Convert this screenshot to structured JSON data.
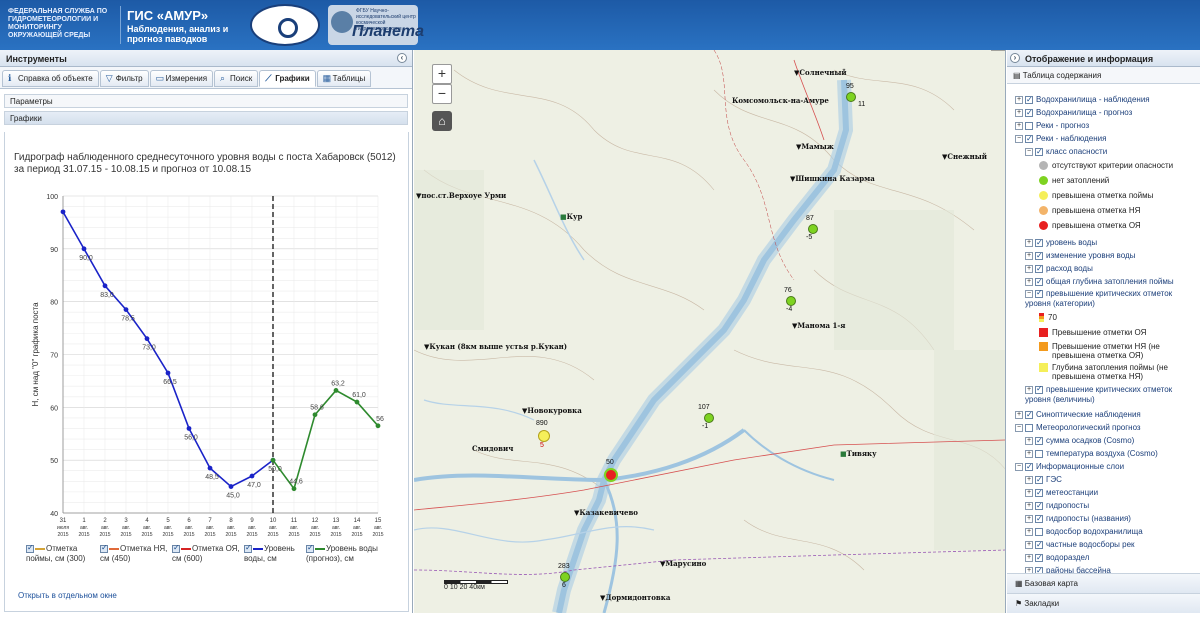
{
  "header": {
    "org": "ФЕДЕРАЛЬНАЯ СЛУЖБА ПО ГИДРОМЕТЕОРОЛОГИИ И МОНИТОРИНГУ ОКРУЖАЮЩЕЙ СРЕДЫ",
    "app_title": "ГИС «АМУР»",
    "app_subtitle": "Наблюдения, анализ и прогноз паводков",
    "logo2_small": "ФГБУ Научно-исследовательский центр космической гидрометеорологии",
    "logo2_big": "Планета"
  },
  "left": {
    "title": "Инструменты",
    "tabs": [
      {
        "label": "Справка об объекте",
        "icon": "info-icon"
      },
      {
        "label": "Фильтр",
        "icon": "filter-icon"
      },
      {
        "label": "Измерения",
        "icon": "ruler-icon"
      },
      {
        "label": "Поиск",
        "icon": "search-icon"
      },
      {
        "label": "Графики",
        "icon": "chart-icon"
      },
      {
        "label": "Таблицы",
        "icon": "table-icon"
      }
    ],
    "params_label": "Параметры",
    "graphs_label": "Графики",
    "open_link": "Открыть в отдельном окне"
  },
  "chart_data": {
    "type": "line",
    "title": "Гидрограф наблюденного среднесуточного уровня воды с поста Хабаровск (5012) за период 31.07.15 - 10.08.15 и прогноз от 10.08.15",
    "ylabel": "H, см над \"0\" графика поста",
    "ylim": [
      40,
      100
    ],
    "yticks": [
      40,
      50,
      60,
      70,
      80,
      90,
      100
    ],
    "xticks": [
      {
        "day": "31",
        "month": "июля",
        "year": "2015"
      },
      {
        "day": "1",
        "month": "авг.",
        "year": "2015"
      },
      {
        "day": "2",
        "month": "авг.",
        "year": "2015"
      },
      {
        "day": "3",
        "month": "авг.",
        "year": "2015"
      },
      {
        "day": "4",
        "month": "авг.",
        "year": "2015"
      },
      {
        "day": "5",
        "month": "авг.",
        "year": "2015"
      },
      {
        "day": "6",
        "month": "авг.",
        "year": "2015"
      },
      {
        "day": "7",
        "month": "авг.",
        "year": "2015"
      },
      {
        "day": "8",
        "month": "авг.",
        "year": "2015"
      },
      {
        "day": "9",
        "month": "авг.",
        "year": "2015"
      },
      {
        "day": "10",
        "month": "авг.",
        "year": "2015"
      },
      {
        "day": "11",
        "month": "авг.",
        "year": "2015"
      },
      {
        "day": "12",
        "month": "авг.",
        "year": "2015"
      },
      {
        "day": "13",
        "month": "авг.",
        "year": "2015"
      },
      {
        "day": "14",
        "month": "авг.",
        "year": "2015"
      },
      {
        "day": "15",
        "month": "авг.",
        "year": "2015"
      }
    ],
    "series": [
      {
        "name": "Уровень воды, см",
        "color": "#1a23c8",
        "x": [
          0,
          1,
          2,
          3,
          4,
          5,
          6,
          7,
          8,
          9,
          10
        ],
        "values": [
          97.0,
          90.0,
          83.0,
          78.5,
          73.0,
          66.5,
          56.0,
          48.5,
          45.0,
          47.0,
          50.0
        ],
        "labels": [
          "",
          "90,0",
          "83,0",
          "78,5",
          "73,0",
          "66,5",
          "56,0",
          "48,5",
          "45,0",
          "47,0",
          "50,0"
        ]
      },
      {
        "name": "Уровень воды (прогноз), см",
        "color": "#2e8a2e",
        "x": [
          10,
          11,
          12,
          13,
          14,
          15
        ],
        "values": [
          50.0,
          44.6,
          58.6,
          63.2,
          61.0,
          56.5
        ],
        "labels": [
          "",
          "44,6",
          "58,6",
          "63,2",
          "61,0",
          "56"
        ]
      }
    ],
    "forecast_divider_x": 10,
    "legend": [
      {
        "label": "Отметка поймы, см (300)",
        "color": "#d4a437"
      },
      {
        "label": "Отметка НЯ, см (450)",
        "color": "#e06a3a"
      },
      {
        "label": "Отметка ОЯ, см (600)",
        "color": "#d62424"
      },
      {
        "label": "Уровень воды, см",
        "color": "#1a23c8"
      },
      {
        "label": "Уровень воды (прогноз), см",
        "color": "#2e8a2e"
      }
    ]
  },
  "map": {
    "zoom_in": "+",
    "zoom_out": "−",
    "scale_label": "0   10   20      40км",
    "labels": [
      {
        "text": "Солнечный"
      },
      {
        "text": "Комсомольск-на-Амуре"
      },
      {
        "text": "Мамыж"
      },
      {
        "text": "Шишкина Казарма"
      },
      {
        "text": "Снежный"
      },
      {
        "text": "пос.ст.Верхоуе Урми"
      },
      {
        "text": "Кур"
      },
      {
        "text": "Кукан (8км выше устья р.Кукан)"
      },
      {
        "text": "Манома 1-я"
      },
      {
        "text": "Новокуровка"
      },
      {
        "text": "Смидович"
      },
      {
        "text": "Тивяку"
      },
      {
        "text": "Казакевичево"
      },
      {
        "text": "Марусино"
      },
      {
        "text": "Дормидонтовка"
      }
    ],
    "gauges": [
      {
        "value": "95",
        "sub": "11"
      },
      {
        "value": "87",
        "sub": "-5"
      },
      {
        "value": "76",
        "sub": "-4"
      },
      {
        "value": "107",
        "sub": "-1"
      },
      {
        "value": "890",
        "sub": "5"
      },
      {
        "value": "50",
        "sub": ""
      },
      {
        "value": "283",
        "sub": "6"
      }
    ]
  },
  "right": {
    "title": "Отображение и информация",
    "toc_title": "Таблица содержания",
    "toc": [
      {
        "label": "Водохранилища - наблюдения",
        "checked": true
      },
      {
        "label": "Водохранилища - прогноз",
        "checked": true
      },
      {
        "label": "Реки - прогноз",
        "checked": false
      },
      {
        "label": "Реки - наблюдения",
        "checked": true
      },
      {
        "label": "класс опасности",
        "checked": true
      },
      {
        "label": "отсутствуют критерии опасности"
      },
      {
        "label": "нет затоплений"
      },
      {
        "label": "превышена отметка поймы"
      },
      {
        "label": "превышена отметка НЯ"
      },
      {
        "label": "превышена отметка ОЯ"
      },
      {
        "label": "уровень воды",
        "checked": true
      },
      {
        "label": "изменение уровня воды",
        "checked": true
      },
      {
        "label": "расход воды",
        "checked": true
      },
      {
        "label": "общая глубина затопления поймы",
        "checked": true
      },
      {
        "label": "превышение критических отметок уровня (категории)",
        "checked": true
      },
      {
        "label": "70"
      },
      {
        "label": "Превышение отметки ОЯ"
      },
      {
        "label": "Превышение отметки НЯ (не превышена отметка ОЯ)"
      },
      {
        "label": "Глубина затопления поймы (не превышена отметка НЯ)"
      },
      {
        "label": "превышение критических отметок уровня (величины)",
        "checked": true
      },
      {
        "label": "Синоптические наблюдения",
        "checked": true
      },
      {
        "label": "Метеорологический прогноз",
        "checked": false
      },
      {
        "label": "сумма осадков (Cosmo)",
        "checked": true
      },
      {
        "label": "температура воздуха (Cosmo)",
        "checked": false
      },
      {
        "label": "Информационные слои",
        "checked": true
      },
      {
        "label": "ГЭС",
        "checked": true
      },
      {
        "label": "метеостанции",
        "checked": true
      },
      {
        "label": "гидропосты",
        "checked": true
      },
      {
        "label": "гидропосты (названия)",
        "checked": true
      },
      {
        "label": "водосбор водохранилища",
        "checked": false
      },
      {
        "label": "частные водосборы рек",
        "checked": true
      },
      {
        "label": "водораздел",
        "checked": true
      },
      {
        "label": "районы бассейна",
        "checked": true
      }
    ],
    "basemap": "Базовая карта",
    "bookmarks": "Закладки"
  }
}
